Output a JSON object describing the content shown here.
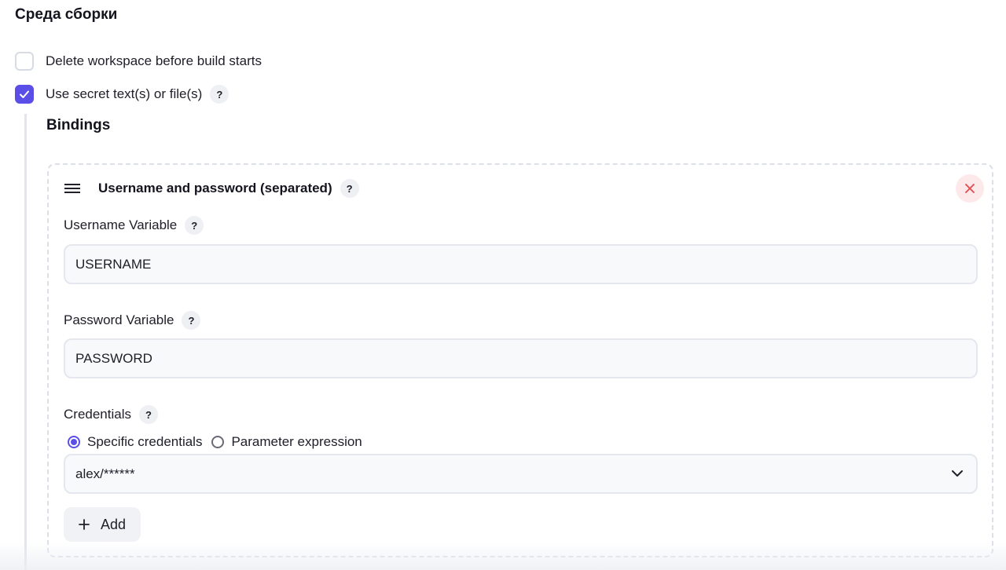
{
  "section": {
    "title": "Среда сборки"
  },
  "options": {
    "delete_workspace": {
      "label": "Delete workspace before build starts",
      "checked": false
    },
    "use_secrets": {
      "label": "Use secret text(s) or file(s)",
      "checked": true,
      "help": "?"
    }
  },
  "bindings": {
    "title": "Bindings",
    "card": {
      "title": "Username and password (separated)",
      "help": "?",
      "close_icon": "x-icon",
      "drag_icon": "hamburger-icon",
      "username_variable": {
        "label": "Username Variable",
        "help": "?",
        "value": "USERNAME"
      },
      "password_variable": {
        "label": "Password Variable",
        "help": "?",
        "value": "PASSWORD"
      },
      "credentials": {
        "label": "Credentials",
        "help": "?",
        "options": [
          {
            "label": "Specific credentials",
            "selected": true
          },
          {
            "label": "Parameter expression",
            "selected": false
          }
        ],
        "selected_value": "alex/******"
      },
      "add_button": {
        "label": "Add",
        "icon": "plus-icon"
      }
    }
  },
  "colors": {
    "accent": "#5b4ee6",
    "close_bg": "#fde8ea",
    "close_fg": "#e5484d"
  }
}
